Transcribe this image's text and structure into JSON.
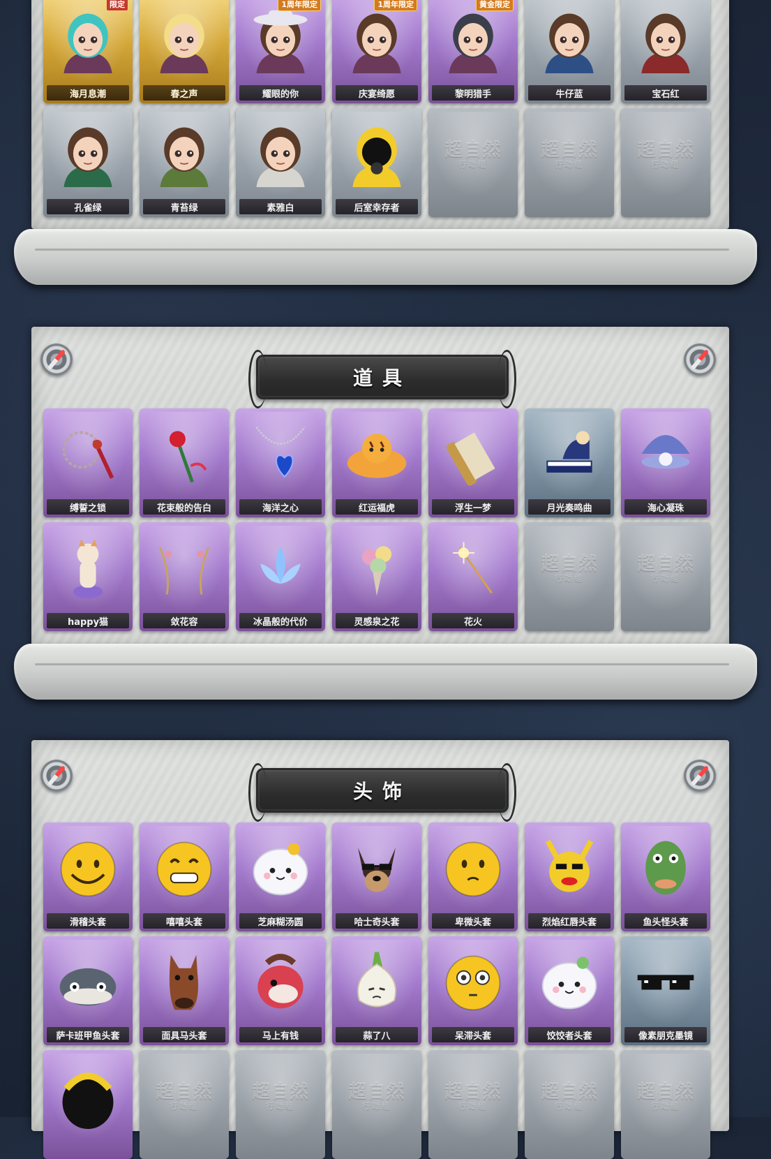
{
  "colors": {
    "gold": "#d4a738",
    "purple": "#a279cc",
    "gray": "#9aa3ab",
    "header_bg": "#2c2c2c",
    "page_bg": "#1b2536"
  },
  "costumes": {
    "rows": [
      [
        {
          "label": "海月息潮",
          "style": "gold",
          "icon": "mermaid-avatar-icon",
          "badge": "限定"
        },
        {
          "label": "春之声",
          "style": "gold",
          "icon": "blonde-girl-avatar-icon",
          "badge": ""
        },
        {
          "label": "耀眼的你",
          "style": "purple",
          "icon": "cowgirl-avatar-icon",
          "badge": "1周年限定"
        },
        {
          "label": "庆宴绮愿",
          "style": "purple",
          "icon": "cake-girl-avatar-icon",
          "badge": "1周年限定"
        },
        {
          "label": "黎明猎手",
          "style": "purple",
          "icon": "hunter-boy-avatar-icon",
          "badge": "黄金限定"
        },
        {
          "label": "牛仔蓝",
          "style": "gray",
          "icon": "girl-blue-avatar-icon",
          "badge": ""
        },
        {
          "label": "宝石红",
          "style": "gray",
          "icon": "girl-red-avatar-icon",
          "badge": ""
        }
      ],
      [
        {
          "label": "孔雀绿",
          "style": "gray",
          "icon": "girl-green-avatar-icon",
          "badge": ""
        },
        {
          "label": "青苔绿",
          "style": "gray",
          "icon": "girl-moss-avatar-icon",
          "badge": ""
        },
        {
          "label": "素雅白",
          "style": "gray",
          "icon": "girl-white-avatar-icon",
          "badge": ""
        },
        {
          "label": "后室幸存者",
          "style": "gray",
          "icon": "hazmat-survivor-avatar-icon",
          "badge": ""
        },
        {
          "label": "",
          "style": "locked",
          "icon": "locked-slot-icon",
          "badge": ""
        },
        {
          "label": "",
          "style": "locked",
          "icon": "locked-slot-icon",
          "badge": ""
        },
        {
          "label": "",
          "style": "locked",
          "icon": "locked-slot-icon",
          "badge": ""
        }
      ]
    ]
  },
  "props": {
    "title": "道具",
    "rows": [
      [
        {
          "label": "缚誓之锁",
          "style": "purple",
          "icon": "chain-lock-icon"
        },
        {
          "label": "花束般的告白",
          "style": "purple",
          "icon": "rose-icon"
        },
        {
          "label": "海洋之心",
          "style": "purple",
          "icon": "heart-necklace-icon"
        },
        {
          "label": "红运福虎",
          "style": "purple",
          "icon": "tiger-plush-icon"
        },
        {
          "label": "浮生一梦",
          "style": "purple",
          "icon": "scroll-icon"
        },
        {
          "label": "月光奏鸣曲",
          "style": "bluegray",
          "icon": "piano-icon"
        },
        {
          "label": "海心凝珠",
          "style": "purple",
          "icon": "pearl-shell-icon"
        }
      ],
      [
        {
          "label": "happy猫",
          "style": "purple",
          "icon": "dancing-cat-icon"
        },
        {
          "label": "敛花容",
          "style": "purple",
          "icon": "flower-vine-icon"
        },
        {
          "label": "冰晶般的代价",
          "style": "purple",
          "icon": "crystal-lotus-icon"
        },
        {
          "label": "灵感泉之花",
          "style": "purple",
          "icon": "bouquet-icon"
        },
        {
          "label": "花火",
          "style": "purple",
          "icon": "sparkler-icon"
        },
        {
          "label": "",
          "style": "locked",
          "icon": "locked-slot-icon"
        },
        {
          "label": "",
          "style": "locked",
          "icon": "locked-slot-icon"
        }
      ]
    ]
  },
  "headwear": {
    "title": "头饰",
    "rows": [
      [
        {
          "label": "滑稽头套",
          "style": "purple",
          "icon": "funny-face-icon"
        },
        {
          "label": "嘻嘻头套",
          "style": "purple",
          "icon": "grin-face-icon"
        },
        {
          "label": "芝麻糊汤圆",
          "style": "purple",
          "icon": "tangyuan-icon"
        },
        {
          "label": "哈士奇头套",
          "style": "purple",
          "icon": "husky-sunglasses-icon"
        },
        {
          "label": "卑微头套",
          "style": "purple",
          "icon": "humble-face-icon"
        },
        {
          "label": "烈焰红唇头套",
          "style": "purple",
          "icon": "pikachu-lips-icon"
        },
        {
          "label": "鱼头怪头套",
          "style": "purple",
          "icon": "fish-head-icon"
        }
      ],
      [
        {
          "label": "萨卡班甲鱼头套",
          "style": "purple",
          "icon": "sacabambaspis-icon"
        },
        {
          "label": "面具马头套",
          "style": "purple",
          "icon": "horse-mask-icon"
        },
        {
          "label": "马上有钱",
          "style": "purple",
          "icon": "red-horse-icon"
        },
        {
          "label": "蒜了八",
          "style": "purple",
          "icon": "garlic-icon"
        },
        {
          "label": "呆滞头套",
          "style": "purple",
          "icon": "dazed-face-icon"
        },
        {
          "label": "饺饺者头套",
          "style": "purple",
          "icon": "dumpling-icon"
        },
        {
          "label": "像素朋克墨镜",
          "style": "bluegray",
          "icon": "pixel-sunglasses-icon"
        }
      ],
      [
        {
          "label": "",
          "style": "purple",
          "icon": "helmet-icon"
        },
        {
          "label": "",
          "style": "locked",
          "icon": "locked-slot-icon"
        },
        {
          "label": "",
          "style": "locked",
          "icon": "locked-slot-icon"
        },
        {
          "label": "",
          "style": "locked",
          "icon": "locked-slot-icon"
        },
        {
          "label": "",
          "style": "locked",
          "icon": "locked-slot-icon"
        },
        {
          "label": "",
          "style": "locked",
          "icon": "locked-slot-icon"
        },
        {
          "label": "",
          "style": "locked",
          "icon": "locked-slot-icon"
        }
      ]
    ]
  },
  "locked_slot": {
    "watermark_main": "超自然",
    "watermark_sub": "行动组"
  }
}
